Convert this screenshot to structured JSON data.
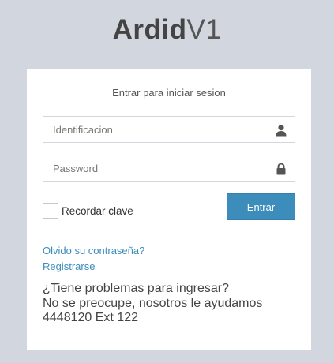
{
  "logo": {
    "brand": "Ardid",
    "version": "V1"
  },
  "login": {
    "message": "Entrar para iniciar sesion",
    "username_placeholder": "Identificacion",
    "username_icon": "user-icon",
    "password_placeholder": "Password",
    "password_icon": "lock-icon",
    "remember_label": "Recordar clave",
    "remember_checked": false,
    "submit_label": "Entrar",
    "forgot_link": "Olvido su contraseña?",
    "register_link": "Registrarse"
  },
  "help": {
    "line1": "¿Tiene problemas para ingresar?",
    "line2": "No se preocupe, nosotros le ayudamos",
    "line3": "4448120 Ext 122"
  },
  "colors": {
    "background": "#d2d6de",
    "accent": "#3c8dbc",
    "panel": "#ffffff"
  }
}
